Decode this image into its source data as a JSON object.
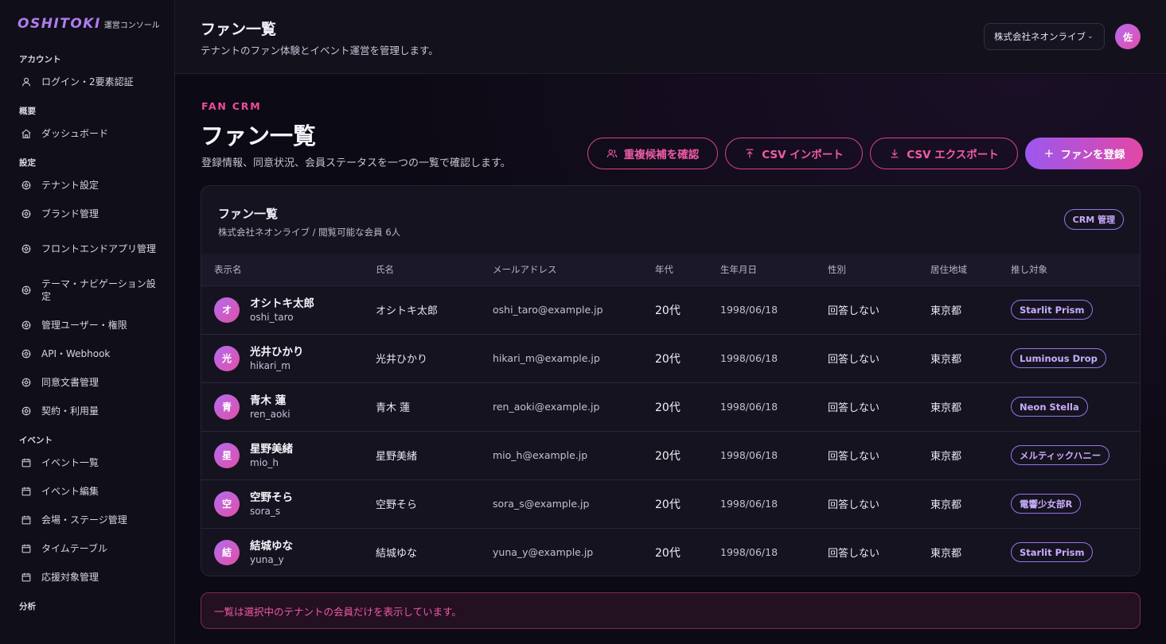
{
  "brand": {
    "logo": "OSHITOKI",
    "subtitle": "運営コンソール"
  },
  "sidebar": {
    "sections": [
      {
        "title": "アカウント",
        "items": [
          {
            "label": "ログイン・2要素認証",
            "icon": "user-icon"
          }
        ]
      },
      {
        "title": "概要",
        "items": [
          {
            "label": "ダッシュボード",
            "icon": "home-icon"
          }
        ]
      },
      {
        "title": "設定",
        "items": [
          {
            "label": "テナント設定",
            "icon": "gear-icon"
          },
          {
            "label": "ブランド管理",
            "icon": "gear-icon"
          },
          {
            "label": "フロントエンドアプリ管理",
            "icon": "gear-icon"
          },
          {
            "label": "テーマ・ナビゲーション設定",
            "icon": "gear-icon"
          },
          {
            "label": "管理ユーザー・権限",
            "icon": "gear-icon"
          },
          {
            "label": "API・Webhook",
            "icon": "gear-icon"
          },
          {
            "label": "同意文書管理",
            "icon": "gear-icon"
          },
          {
            "label": "契約・利用量",
            "icon": "gear-icon"
          }
        ]
      },
      {
        "title": "イベント",
        "items": [
          {
            "label": "イベント一覧",
            "icon": "calendar-icon"
          },
          {
            "label": "イベント編集",
            "icon": "calendar-icon"
          },
          {
            "label": "会場・ステージ管理",
            "icon": "calendar-icon"
          },
          {
            "label": "タイムテーブル",
            "icon": "calendar-icon"
          },
          {
            "label": "応援対象管理",
            "icon": "calendar-icon"
          }
        ]
      },
      {
        "title": "分析",
        "items": []
      }
    ]
  },
  "header": {
    "title": "ファン一覧",
    "subtitle": "テナントのファン体験とイベント運営を管理します。",
    "tenant": "株式会社ネオンライブ",
    "avatar": "佐"
  },
  "page": {
    "eyebrow": "FAN CRM",
    "title": "ファン一覧",
    "description": "登録情報、同意状況、会員ステータスを一つの一覧で確認します。"
  },
  "actions": {
    "duplicates": "重複候補を確認",
    "import": "CSV インポート",
    "export": "CSV エクスポート",
    "register": "ファンを登録"
  },
  "card": {
    "title": "ファン一覧",
    "subtitle": "株式会社ネオンライブ / 閲覧可能な会員 6人",
    "badge": "CRM 管理"
  },
  "table": {
    "columns": [
      "表示名",
      "氏名",
      "メールアドレス",
      "年代",
      "生年月日",
      "性別",
      "居住地域",
      "推し対象"
    ],
    "rows": [
      {
        "initial": "オ",
        "display": "オシトキ太郎",
        "handle": "oshi_taro",
        "name": "オシトキ太郎",
        "email": "oshi_taro@example.jp",
        "age": "20代",
        "birth": "1998/06/18",
        "gender": "回答しない",
        "region": "東京都",
        "oshi": "Starlit Prism"
      },
      {
        "initial": "光",
        "display": "光井ひかり",
        "handle": "hikari_m",
        "name": "光井ひかり",
        "email": "hikari_m@example.jp",
        "age": "20代",
        "birth": "1998/06/18",
        "gender": "回答しない",
        "region": "東京都",
        "oshi": "Luminous Drop"
      },
      {
        "initial": "青",
        "display": "青木 蓮",
        "handle": "ren_aoki",
        "name": "青木 蓮",
        "email": "ren_aoki@example.jp",
        "age": "20代",
        "birth": "1998/06/18",
        "gender": "回答しない",
        "region": "東京都",
        "oshi": "Neon Stella"
      },
      {
        "initial": "星",
        "display": "星野美緒",
        "handle": "mio_h",
        "name": "星野美緒",
        "email": "mio_h@example.jp",
        "age": "20代",
        "birth": "1998/06/18",
        "gender": "回答しない",
        "region": "東京都",
        "oshi": "メルティックハニー"
      },
      {
        "initial": "空",
        "display": "空野そら",
        "handle": "sora_s",
        "name": "空野そら",
        "email": "sora_s@example.jp",
        "age": "20代",
        "birth": "1998/06/18",
        "gender": "回答しない",
        "region": "東京都",
        "oshi": "電響少女部R"
      },
      {
        "initial": "結",
        "display": "結城ゆな",
        "handle": "yuna_y",
        "name": "結城ゆな",
        "email": "yuna_y@example.jp",
        "age": "20代",
        "birth": "1998/06/18",
        "gender": "回答しない",
        "region": "東京都",
        "oshi": "Starlit Prism"
      }
    ]
  },
  "notice": "一覧は選択中のテナントの会員だけを表示しています。",
  "colors": {
    "accent": "#ec4d9b",
    "purple": "#9b58ef",
    "background": "#0c0a15"
  }
}
